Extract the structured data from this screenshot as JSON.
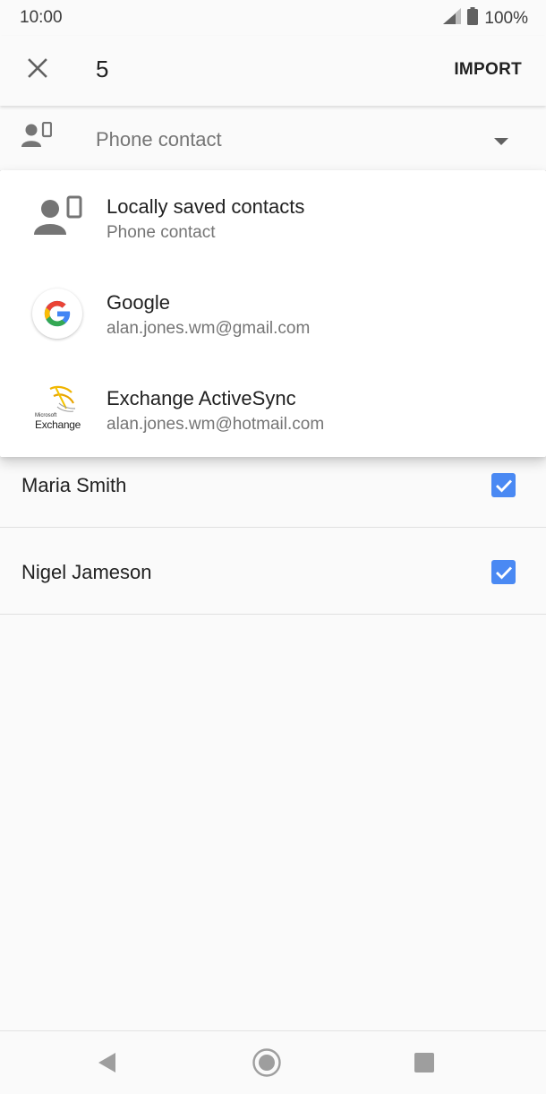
{
  "status_bar": {
    "time": "10:00",
    "battery": "100%",
    "icons": [
      "signal-icon",
      "battery-icon"
    ]
  },
  "app_bar": {
    "close_icon": "close-icon",
    "count": "5",
    "import_label": "IMPORT"
  },
  "account_selector": {
    "icon": "phone-contact-icon",
    "label": "Phone contact",
    "caret_icon": "dropdown-caret-icon"
  },
  "dropdown": {
    "items": [
      {
        "title": "Locally saved contacts",
        "subtitle": "Phone contact",
        "icon": "phone-contact-icon"
      },
      {
        "title": "Google",
        "subtitle": "alan.jones.wm@gmail.com",
        "icon": "google-logo-icon"
      },
      {
        "title": "Exchange ActiveSync",
        "subtitle": "alan.jones.wm@hotmail.com",
        "icon": "exchange-logo-icon",
        "logo_text_small": "Microsoft",
        "logo_text": "Exchange"
      }
    ]
  },
  "contacts": [
    {
      "name": "Maria Smith",
      "checked": true
    },
    {
      "name": "Nigel Jameson",
      "checked": true
    }
  ],
  "nav_bar": {
    "icons": [
      "back-icon",
      "home-icon",
      "recents-icon"
    ]
  },
  "colors": {
    "accent": "#4a89f3",
    "background": "#fafafa",
    "icon_grey": "#757575"
  }
}
